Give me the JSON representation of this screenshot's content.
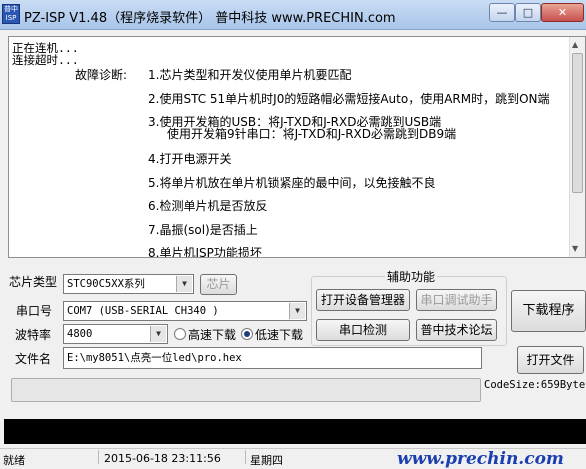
{
  "window": {
    "title": "PZ-ISP V1.48（程序烧录软件） 普中科技 www.PRECHIN.com",
    "app_icon_text": "普中ISP",
    "minimize": "—",
    "maximize": "□",
    "close": "✕"
  },
  "log": {
    "lines": [
      "正在连机...",
      "连接超时..."
    ],
    "diag_label": "故障诊断:",
    "items": [
      "1.芯片类型和开发仪使用单片机要匹配",
      "2.使用STC 51单片机时J0的短路帽必需短接Auto，使用ARM时，跳到ON端",
      "3.使用开发箱的USB：将J-TXD和J-RXD必需跳到USB端",
      "使用开发箱9针串口：将J-TXD和J-RXD必需跳到DB9端",
      "4.打开电源开关",
      "5.将单片机放在单片机锁紧座的最中间，以免接触不良",
      "6.检测单片机是否放反",
      "7.晶振(sol)是否插上",
      "8.单片机ISP功能损坏"
    ]
  },
  "chip": {
    "label": "芯片类型",
    "value": "STC90C5XX系列",
    "button": "芯片"
  },
  "port": {
    "label": "串口号",
    "value": "COM7 (USB-SERIAL CH340 )"
  },
  "baud": {
    "label": "波特率",
    "value": "4800",
    "high_speed": "高速下载",
    "low_speed": "低速下载",
    "selected": "low"
  },
  "file": {
    "label": "文件名",
    "value": "E:\\my8051\\点亮一位led\\pro.hex",
    "open_button": "打开文件"
  },
  "aux": {
    "title": "辅助功能",
    "open_device_manager": "打开设备管理器",
    "serial_debug": "串口调试助手",
    "serial_detect": "串口检测",
    "forum": "普中技术论坛"
  },
  "download_button": "下载程序",
  "code_size": "CodeSize:659Byte",
  "progress": 0,
  "status": {
    "state": "就绪",
    "datetime": "2015-06-18  23:11:56",
    "weekday": "星期四",
    "website": "www.prechin.com"
  }
}
